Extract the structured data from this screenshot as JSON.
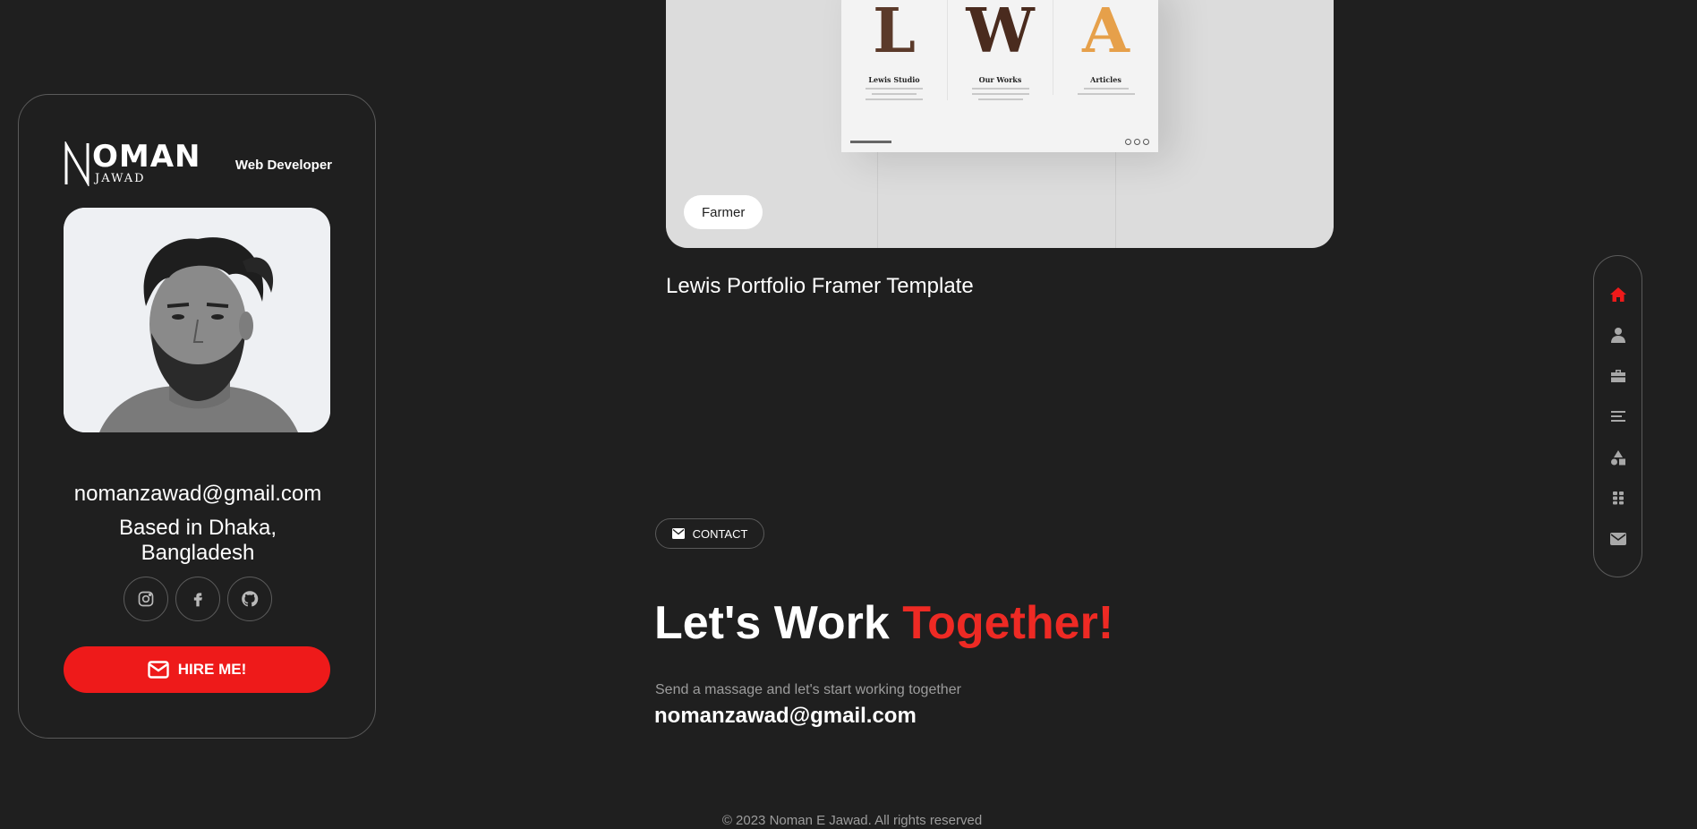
{
  "profile": {
    "logo_main": "OMAN",
    "logo_sub": "JAWAD",
    "role": "Web Developer",
    "email": "nomanzawad@gmail.com",
    "location": "Based in Dhaka, Bangladesh",
    "socials": [
      {
        "name": "instagram-icon"
      },
      {
        "name": "facebook-icon"
      },
      {
        "name": "github-icon"
      }
    ],
    "hire_label": "HIRE ME!"
  },
  "project": {
    "preview_columns": [
      {
        "letter": "L",
        "title": "Lewis Studio"
      },
      {
        "letter": "W",
        "title": "Our Works"
      },
      {
        "letter": "A",
        "title": "Articles"
      }
    ],
    "tag": "Farmer",
    "title": "Lewis Portfolio Framer Template"
  },
  "contact": {
    "tag_label": "CONTACT",
    "heading_main": "Let's Work ",
    "heading_accent": "Together!",
    "subtext": "Send a massage and let's start working together",
    "email": "nomanzawad@gmail.com"
  },
  "footer": {
    "text": "© 2023 Noman E Jawad. All rights reserved"
  },
  "nav": {
    "items": [
      {
        "name": "home-icon",
        "active": true
      },
      {
        "name": "user-icon",
        "active": false
      },
      {
        "name": "briefcase-icon",
        "active": false
      },
      {
        "name": "menu-lines-icon",
        "active": false
      },
      {
        "name": "shapes-icon",
        "active": false
      },
      {
        "name": "grid-icon",
        "active": false
      },
      {
        "name": "envelope-icon",
        "active": false
      }
    ]
  },
  "colors": {
    "background": "#1f1f1f",
    "accent": "#ee1a1a",
    "muted_text": "#9c9c9c",
    "border": "#5a5a5a"
  }
}
